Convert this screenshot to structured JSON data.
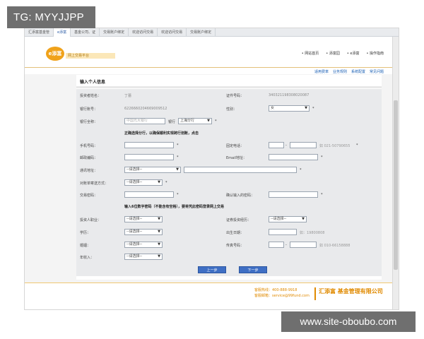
{
  "watermarks": {
    "top": "TG: MYYJJPP",
    "bottom": "www.site-oboubo.com"
  },
  "tabs": [
    "汇添富基金管",
    "e添富",
    "基金公司、证",
    "交易账户绑定",
    "欢迎访问交易",
    "欢迎访问交易",
    "交易账户绑定"
  ],
  "header": {
    "logo": "e添富",
    "logo_sub": "网上交易平台",
    "top_links": [
      "• 网站首页",
      "• 添富园",
      "• e添富",
      "• 操作指南"
    ],
    "sub_links": [
      "适用费率",
      "业务规则",
      "系统配置",
      "常见问题"
    ]
  },
  "panel": {
    "title": "输入个人信息",
    "fields": {
      "investor_name_label": "投资者姓名：",
      "investor_name_value": "丁蕾",
      "id_no_label": "证件号码：",
      "id_no_value": "340321198308020087",
      "bank_account_label": "银行账号：",
      "bank_account_value": "6226660204669009512",
      "gender_label": "性别：",
      "gender_value": "女",
      "bank_name_label": "银行全称：",
      "bank_name_placeholder": "中国光大银行",
      "branch_text": "银行",
      "branch_value": "上海分行",
      "note1": "正确选择分行，以确保顺利实现跨行划账，点击",
      "mobile_label": "手机号码：",
      "phone_label": "固定电话：",
      "phone_hint": "如 021-50790655",
      "zip_label": "邮政编码：",
      "email_label": "Email地址：",
      "address_label": "通讯地址：",
      "address_select": "--请选择--",
      "statement_label": "对账单寄送方式：",
      "statement_select": "--请选择--",
      "trade_pwd_label": "交易密码：",
      "confirm_pwd_label": "确认输入的密码：",
      "note2": "输入6位数字密码（不能含有空格），要将凭此密码登录网上交易",
      "job_label": "投资人职业：",
      "job_select": "--请选择--",
      "experience_label": "证券投资经历：",
      "experience_select": "--请选择--",
      "education_label": "学历：",
      "education_select": "--请选择--",
      "birthday_label": "出生日期：",
      "birthday_hint": "如：19800808",
      "marital_label": "婚姻：",
      "marital_select": "--请选择--",
      "fax_label": "传真号码：",
      "fax_hint": "如 010-66158888",
      "income_label": "年收入：",
      "income_select": "--请选择--"
    },
    "buttons": {
      "prev": "上一步",
      "next": "下一步"
    }
  },
  "footer": {
    "line1": "客服热线：400-888-9918",
    "line2": "客服邮箱：service@99fund.com",
    "logo": "汇添富 基金管理有限公司"
  }
}
